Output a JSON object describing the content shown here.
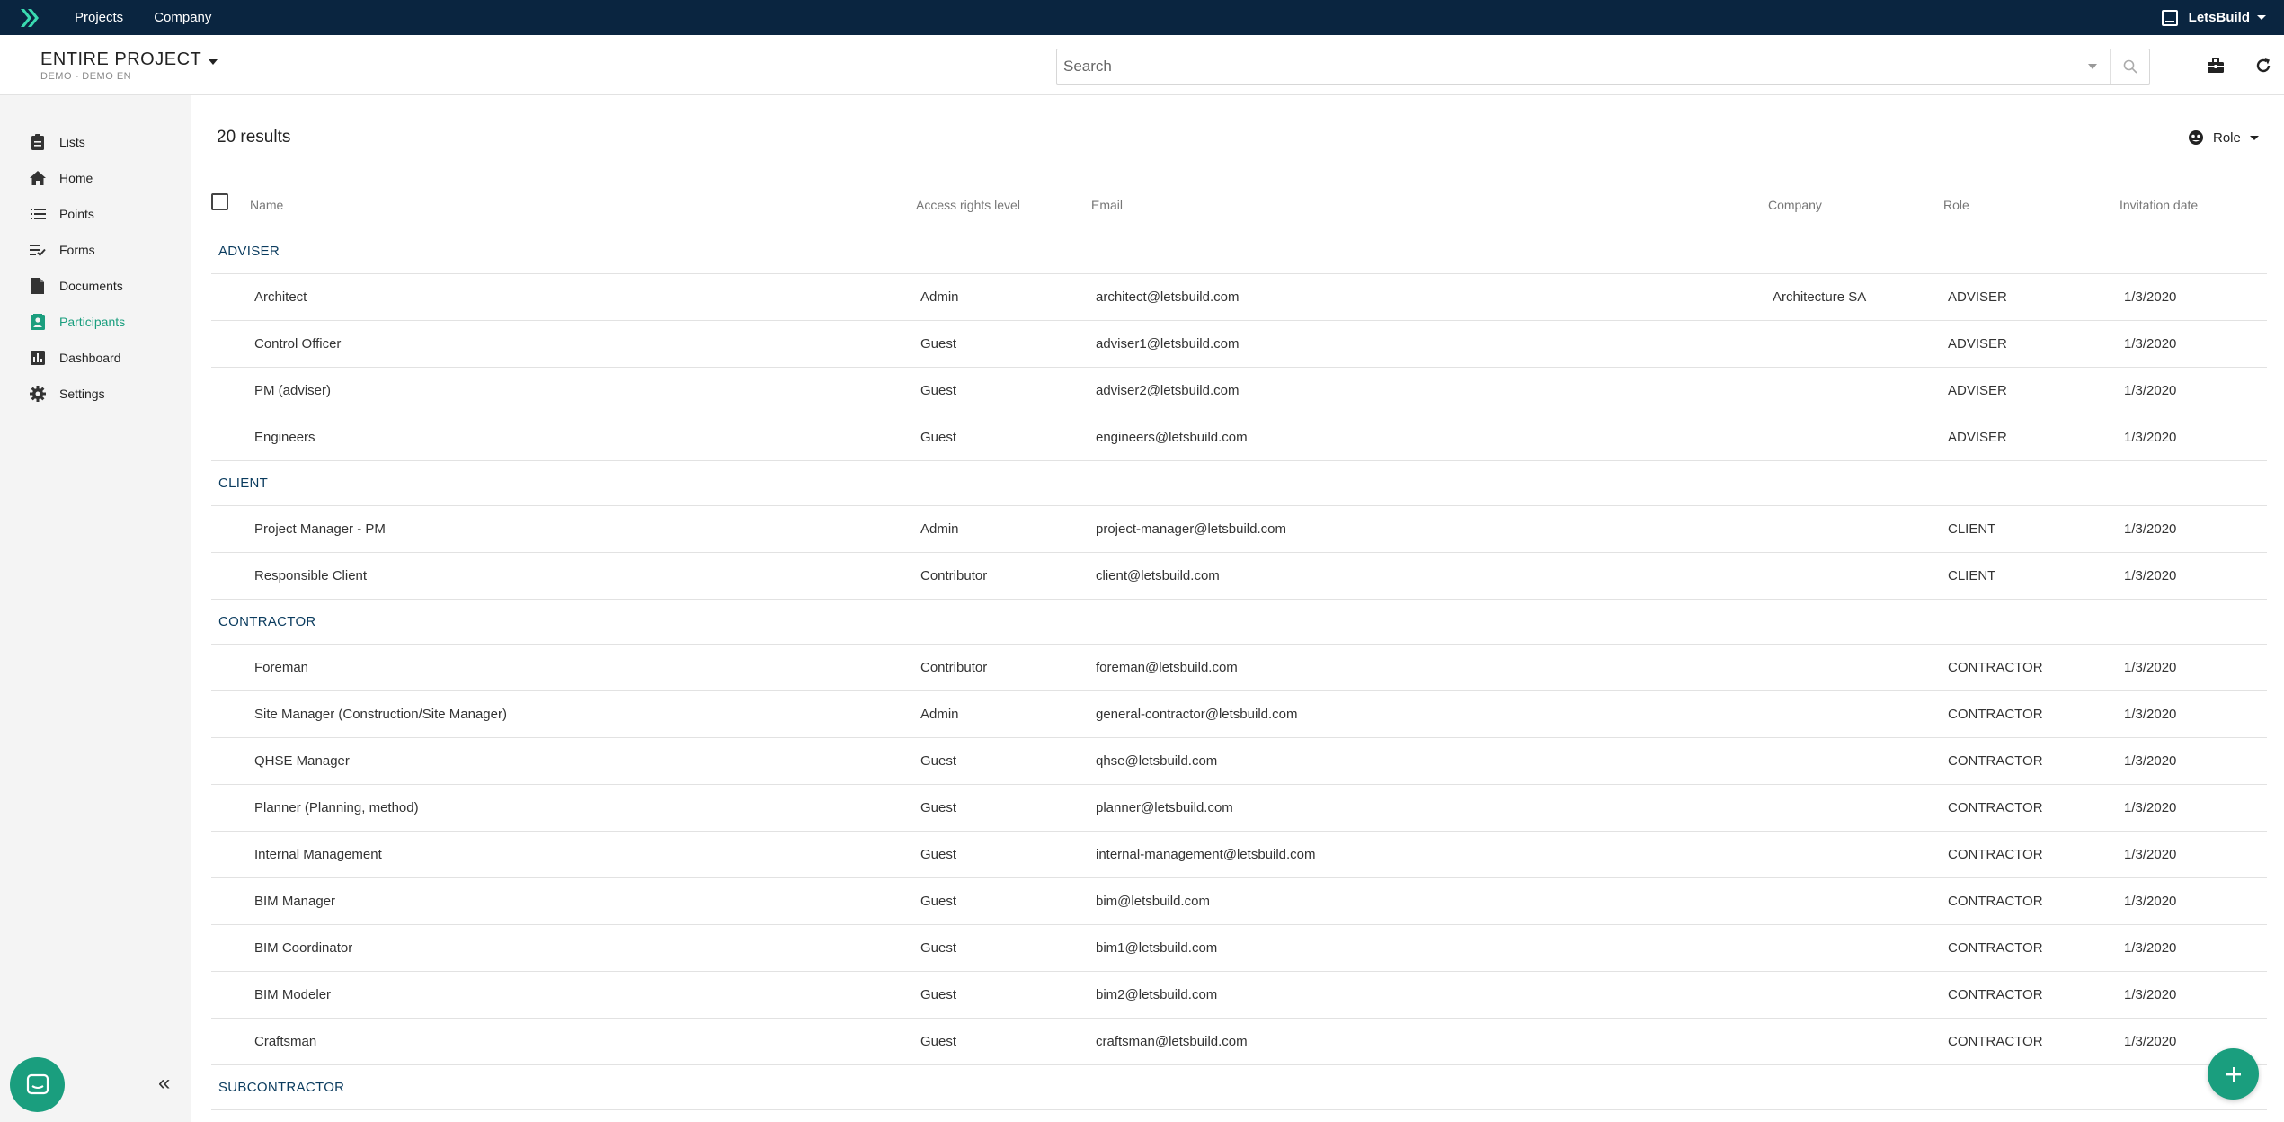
{
  "topbar": {
    "nav": [
      "Projects",
      "Company"
    ],
    "workspace": "LetsBuild"
  },
  "header": {
    "project_title": "ENTIRE PROJECT",
    "project_sub": "DEMO - DEMO EN",
    "search_placeholder": "Search"
  },
  "sidebar": {
    "items": [
      {
        "label": "Lists",
        "icon": "clipboard-icon"
      },
      {
        "label": "Home",
        "icon": "home-icon"
      },
      {
        "label": "Points",
        "icon": "list-icon"
      },
      {
        "label": "Forms",
        "icon": "checklist-icon"
      },
      {
        "label": "Documents",
        "icon": "document-icon"
      },
      {
        "label": "Participants",
        "icon": "participants-icon",
        "active": true
      },
      {
        "label": "Dashboard",
        "icon": "chart-icon"
      },
      {
        "label": "Settings",
        "icon": "gear-icon"
      }
    ],
    "accent": "#1a9e7e"
  },
  "main": {
    "results_label": "20 results",
    "role_filter": "Role",
    "columns": [
      "Name",
      "Access rights level",
      "Email",
      "Company",
      "Role",
      "Invitation date"
    ],
    "groups": [
      {
        "title": "ADVISER",
        "rows": [
          {
            "name": "Architect",
            "access": "Admin",
            "email": "architect@letsbuild.com",
            "company": "Architecture SA",
            "role": "ADVISER",
            "date": "1/3/2020"
          },
          {
            "name": "Control Officer",
            "access": "Guest",
            "email": "adviser1@letsbuild.com",
            "company": "",
            "role": "ADVISER",
            "date": "1/3/2020"
          },
          {
            "name": "PM (adviser)",
            "access": "Guest",
            "email": "adviser2@letsbuild.com",
            "company": "",
            "role": "ADVISER",
            "date": "1/3/2020"
          },
          {
            "name": "Engineers",
            "access": "Guest",
            "email": "engineers@letsbuild.com",
            "company": "",
            "role": "ADVISER",
            "date": "1/3/2020"
          }
        ]
      },
      {
        "title": "CLIENT",
        "rows": [
          {
            "name": "Project Manager - PM",
            "access": "Admin",
            "email": "project-manager@letsbuild.com",
            "company": "",
            "role": "CLIENT",
            "date": "1/3/2020"
          },
          {
            "name": "Responsible Client",
            "access": "Contributor",
            "email": "client@letsbuild.com",
            "company": "",
            "role": "CLIENT",
            "date": "1/3/2020"
          }
        ]
      },
      {
        "title": "CONTRACTOR",
        "rows": [
          {
            "name": "Foreman",
            "access": "Contributor",
            "email": "foreman@letsbuild.com",
            "company": "",
            "role": "CONTRACTOR",
            "date": "1/3/2020"
          },
          {
            "name": "Site Manager (Construction/Site Manager)",
            "access": "Admin",
            "email": "general-contractor@letsbuild.com",
            "company": "",
            "role": "CONTRACTOR",
            "date": "1/3/2020"
          },
          {
            "name": "QHSE Manager",
            "access": "Guest",
            "email": "qhse@letsbuild.com",
            "company": "",
            "role": "CONTRACTOR",
            "date": "1/3/2020"
          },
          {
            "name": "Planner (Planning, method)",
            "access": "Guest",
            "email": "planner@letsbuild.com",
            "company": "",
            "role": "CONTRACTOR",
            "date": "1/3/2020"
          },
          {
            "name": "Internal Management",
            "access": "Guest",
            "email": "internal-management@letsbuild.com",
            "company": "",
            "role": "CONTRACTOR",
            "date": "1/3/2020"
          },
          {
            "name": "BIM Manager",
            "access": "Guest",
            "email": "bim@letsbuild.com",
            "company": "",
            "role": "CONTRACTOR",
            "date": "1/3/2020"
          },
          {
            "name": "BIM Coordinator",
            "access": "Guest",
            "email": "bim1@letsbuild.com",
            "company": "",
            "role": "CONTRACTOR",
            "date": "1/3/2020"
          },
          {
            "name": "BIM Modeler",
            "access": "Guest",
            "email": "bim2@letsbuild.com",
            "company": "",
            "role": "CONTRACTOR",
            "date": "1/3/2020"
          },
          {
            "name": "Craftsman",
            "access": "Guest",
            "email": "craftsman@letsbuild.com",
            "company": "",
            "role": "CONTRACTOR",
            "date": "1/3/2020"
          }
        ]
      },
      {
        "title": "SUBCONTRACTOR",
        "rows": []
      }
    ]
  },
  "colors": {
    "topbar": "#0a2540",
    "accent": "#1a9e7e",
    "group_title": "#0a3b5e"
  }
}
